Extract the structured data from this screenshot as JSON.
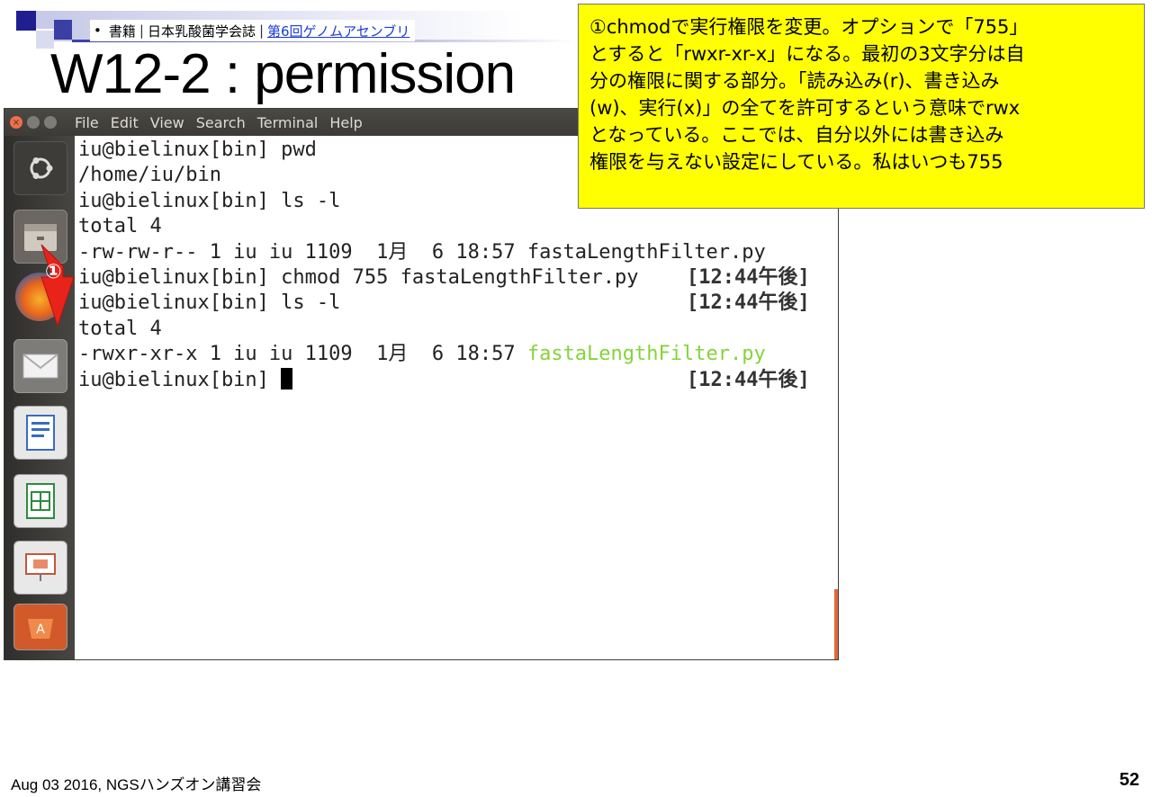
{
  "slide": {
    "source_bullet": "•",
    "source_prefix": "書籍",
    "source_journal": "日本乳酸菌学会誌",
    "source_link": "第6回ゲノムアセンブリ",
    "title": "W12-2 : permission",
    "footer": "Aug 03 2016, NGSハンズオン講習会",
    "page_number": "52"
  },
  "note": {
    "lines": [
      "①chmodで実行権限を変更。オプションで「755」",
      "とすると「rwxr-xr-x」になる。最初の3文字分は自",
      "分の権限に関する部分。「読み込み(r)、書き込み",
      "(w)、実行(x)」の全てを許可するという意味でrwx",
      "となっている。ここでは、自分以外には書き込み",
      "権限を与えない設定にしている。私はいつも755"
    ]
  },
  "marker": {
    "label": "①",
    "color": "#e8231a"
  },
  "window": {
    "menu": [
      "File",
      "Edit",
      "View",
      "Search",
      "Terminal",
      "Help"
    ]
  },
  "launcher": [
    "ubuntu-dash-icon",
    "files-icon",
    "firefox-icon",
    "mail-icon",
    "writer-icon",
    "calc-icon",
    "impress-icon",
    "software-center-icon"
  ],
  "terminal": {
    "lines": [
      {
        "text": "iu@bielinux[bin] pwd",
        "ts": ""
      },
      {
        "text": "/home/iu/bin",
        "ts": ""
      },
      {
        "text": "iu@bielinux[bin] ls -l",
        "ts": ""
      },
      {
        "text": "total 4",
        "ts": ""
      },
      {
        "text": "-rw-rw-r-- 1 iu iu 1109  1月  6 18:57 fastaLengthFilter.py",
        "ts": ""
      },
      {
        "text": "iu@bielinux[bin] chmod 755 fastaLengthFilter.py",
        "ts": "[12:44午後]"
      },
      {
        "text": "iu@bielinux[bin] ls -l",
        "ts": "[12:44午後]"
      },
      {
        "text": "total 4",
        "ts": ""
      },
      {
        "text": "-rwxr-xr-x 1 iu iu 1109  1月  6 18:57 ",
        "green": "fastaLengthFilter.py",
        "ts": ""
      },
      {
        "text": "iu@bielinux[bin] ",
        "cursor": true,
        "ts": "[12:44午後]"
      }
    ],
    "exec_color": "#86d33a"
  }
}
